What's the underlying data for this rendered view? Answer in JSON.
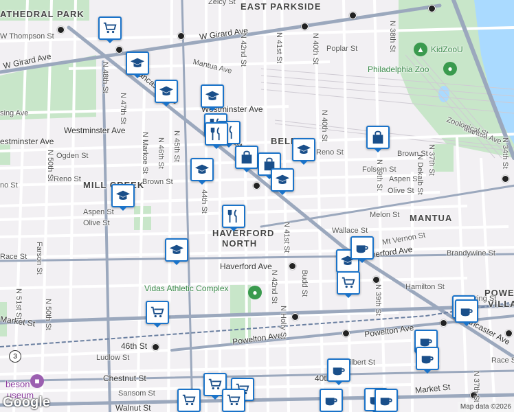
{
  "map": {
    "neighborhoods": {
      "cathedral_park": "ATHEDRAL PARK",
      "east_parkside": "EAST PARKSIDE",
      "mill_creek": "MILL CREEK",
      "belmont": "BELM",
      "haverford_north_1": "HAVERFORD",
      "haverford_north_2": "NORTH",
      "mantua": "MANTUA",
      "powelton_1": "POWEL",
      "powelton_2": "VILLA"
    },
    "streets": {
      "zelcy": "Zelcy St",
      "w_thompson": "W Thompson St",
      "w_girard_1": "W Girard Ave",
      "w_girard_2": "W Girard Ave",
      "poplar": "Poplar St",
      "mantua_1": "Mantua Ave",
      "n_48th": "N 48th St",
      "n_47th": "N 47th St",
      "lancaster_1": "Lancaster Ave",
      "lancaster_2": "Lancaster Ave",
      "lancaster_3": "Lancaster Ave",
      "sing": "sing Ave",
      "westminster_1": "Westminster Ave",
      "westminster_2": "Westminster Ave",
      "westminster_3": "estminster Ave",
      "n_markoe": "N Markoe St",
      "n_46th": "N 46th St",
      "n_45th": "N 45th St",
      "n_44th_1": "44th St",
      "n_43rd": "N 42nd St",
      "n_42nd": "N 42nd St",
      "n_41st": "N 41st St",
      "n_41st_2": "N 41st St",
      "n_40th": "N 40th St",
      "n_40th_2": "N 40th St",
      "n_38th": "N 38th St",
      "ogden": "Ogden St",
      "n_50th": "N 50th St",
      "reno_1": "Reno St",
      "reno_2": "Reno St",
      "reno_3": "no St",
      "brown_1": "Brown St",
      "brown_2": "Brown St",
      "aspen_1": "Aspen St",
      "aspen_2": "Aspen St",
      "olive_1": "Olive St",
      "olive_2": "Olive St",
      "folsom": "Folsom St",
      "melon": "Melon St",
      "wallace": "Wallace St",
      "mt_vernon": "Mt Vernon St",
      "haverford_1": "Haverford Ave",
      "haverford_2": "verford Ave",
      "brandywine": "Brandywine St",
      "n_deklab": "N Dekalb St",
      "n_39th": "N 39th St",
      "n_39th_2": "N 39th St",
      "n_37th": "N 37th St",
      "n_34th": "N 34th St",
      "mantua_2": "Mantua Ave",
      "zoological": "Zoological St",
      "race": "Race St",
      "farson": "Farson St",
      "n_51st": "N 51st St",
      "n_50th_2": "N 50th St",
      "budd": "Budd St",
      "hamilton": "Hamilton St",
      "baring": "Baring St",
      "n_holly": "N Holly St",
      "market_1": "Market St",
      "market_2": "Market St",
      "powelton_ave_1": "Powelton Ave",
      "powelton_ave_2": "Powelton Ave",
      "lancaster_4": "Lancaster Ave",
      "st_46th": "46th St",
      "ludlow": "Ludlow St",
      "chestnut": "Chestnut St",
      "sansom": "Sansom St",
      "walnut": "Walnut St",
      "filbert": "Filbert St",
      "race_2": "Race St",
      "st_40th": "40th",
      "n_37th_2": "N 37th St",
      "n_34th_2": "N 34th St",
      "haverford_n42": "N 42nd St",
      "mt_vernon_2": "Mt Vernon St"
    },
    "pois": {
      "kidzoou": "KidZooU",
      "philadelphia_zoo": "Philadelphia Zoo",
      "vidas": "Vidas Athletic Complex",
      "robeson_1": "beson",
      "robeson_2": "useum"
    },
    "shield_number": "3",
    "logo": "Google",
    "attribution": "Map data ©2026"
  },
  "colors": {
    "marker_border": "#1a73c9",
    "marker_icon": "#1a4f8a",
    "park": "#c8e6c9",
    "water": "#aadaff",
    "arterial": "#9ba8bd",
    "street": "#ffffff"
  },
  "markers": [
    {
      "type": "grocery",
      "name": "grocery-marker"
    },
    {
      "type": "school",
      "name": "school-marker"
    },
    {
      "type": "school",
      "name": "school-marker"
    },
    {
      "type": "school",
      "name": "school-marker"
    },
    {
      "type": "restaurant",
      "name": "restaurant-marker"
    },
    {
      "type": "restaurant",
      "name": "restaurant-marker"
    },
    {
      "type": "shopping",
      "name": "shopping-marker"
    },
    {
      "type": "school",
      "name": "school-marker"
    },
    {
      "type": "shopping",
      "name": "shopping-marker"
    },
    {
      "type": "school",
      "name": "school-marker"
    },
    {
      "type": "school",
      "name": "school-marker"
    },
    {
      "type": "restaurant",
      "name": "restaurant-marker"
    },
    {
      "type": "restaurant",
      "name": "restaurant-marker"
    },
    {
      "type": "shopping",
      "name": "shopping-marker"
    },
    {
      "type": "school",
      "name": "school-marker"
    },
    {
      "type": "school",
      "name": "school-marker"
    },
    {
      "type": "cafe",
      "name": "cafe-marker"
    },
    {
      "type": "school",
      "name": "school-marker"
    },
    {
      "type": "grocery",
      "name": "grocery-marker"
    },
    {
      "type": "grocery",
      "name": "grocery-marker"
    },
    {
      "type": "cafe",
      "name": "cafe-marker"
    },
    {
      "type": "cafe",
      "name": "cafe-marker"
    },
    {
      "type": "cafe",
      "name": "cafe-marker"
    },
    {
      "type": "cafe",
      "name": "cafe-marker"
    },
    {
      "type": "cafe",
      "name": "cafe-marker"
    },
    {
      "type": "grocery",
      "name": "grocery-marker"
    },
    {
      "type": "grocery",
      "name": "grocery-marker"
    },
    {
      "type": "grocery",
      "name": "grocery-marker"
    },
    {
      "type": "grocery",
      "name": "grocery-marker"
    },
    {
      "type": "cafe",
      "name": "cafe-marker"
    },
    {
      "type": "cafe",
      "name": "cafe-marker"
    },
    {
      "type": "cafe",
      "name": "cafe-marker"
    }
  ]
}
